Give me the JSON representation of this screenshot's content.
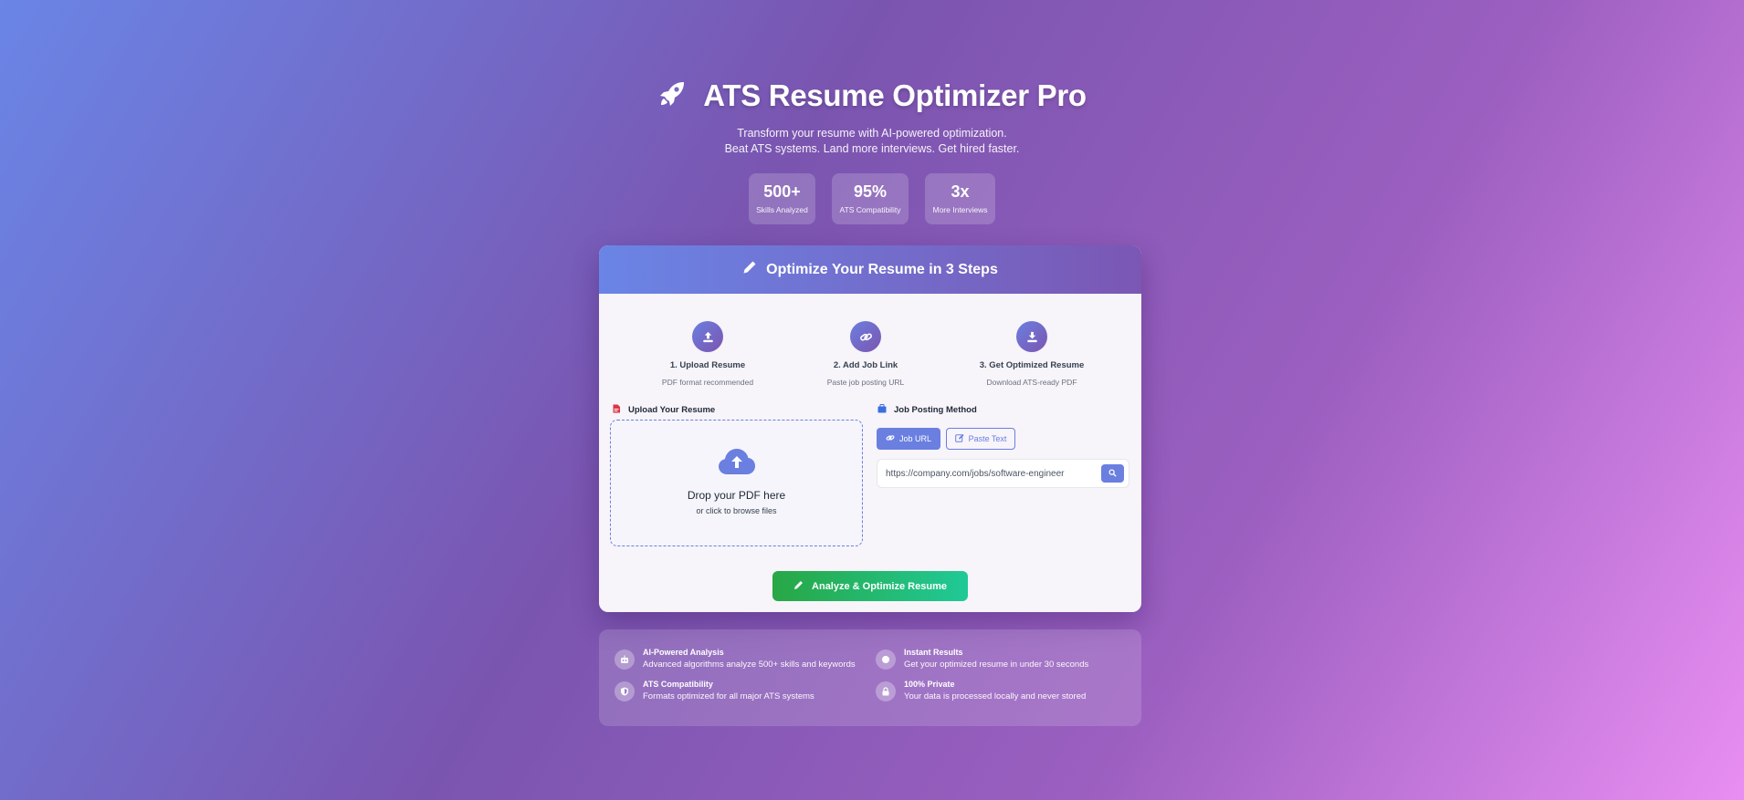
{
  "hero": {
    "title": "ATS Resume Optimizer Pro",
    "subtitle_line1": "Transform your resume with AI-powered optimization.",
    "subtitle_line2": "Beat ATS systems. Land more interviews. Get hired faster.",
    "icon": "rocket-icon"
  },
  "stats": [
    {
      "value": "500+",
      "label": "Skills Analyzed"
    },
    {
      "value": "95%",
      "label": "ATS Compatibility"
    },
    {
      "value": "3x",
      "label": "More Interviews"
    }
  ],
  "card": {
    "header": "Optimize Your Resume in 3 Steps",
    "steps": [
      {
        "title": "1. Upload Resume",
        "subtitle": "PDF format recommended",
        "icon": "upload-icon"
      },
      {
        "title": "2. Add Job Link",
        "subtitle": "Paste job posting URL",
        "icon": "link-icon"
      },
      {
        "title": "3. Get Optimized Resume",
        "subtitle": "Download ATS-ready PDF",
        "icon": "download-icon"
      }
    ],
    "upload": {
      "label": "Upload Your Resume",
      "drop_title": "Drop your PDF here",
      "drop_sub": "or click to browse files"
    },
    "job": {
      "label": "Job Posting Method",
      "tab_url": "Job URL",
      "tab_text": "Paste Text",
      "url_placeholder": "https://company.com/jobs/software-engineer"
    },
    "analyze_label": "Analyze & Optimize Resume"
  },
  "features": [
    {
      "title": "AI-Powered Analysis",
      "desc": "Advanced algorithms analyze 500+ skills and keywords",
      "icon": "robot-icon"
    },
    {
      "title": "Instant Results",
      "desc": "Get your optimized resume in under 30 seconds",
      "icon": "clock-icon"
    },
    {
      "title": "ATS Compatibility",
      "desc": "Formats optimized for all major ATS systems",
      "icon": "shield-icon"
    },
    {
      "title": "100% Private",
      "desc": "Your data is processed locally and never stored",
      "icon": "lock-icon"
    }
  ],
  "colors": {
    "accent": "#6a7fe0",
    "analyze_green": "#28a745",
    "analyze_teal": "#20c997"
  }
}
